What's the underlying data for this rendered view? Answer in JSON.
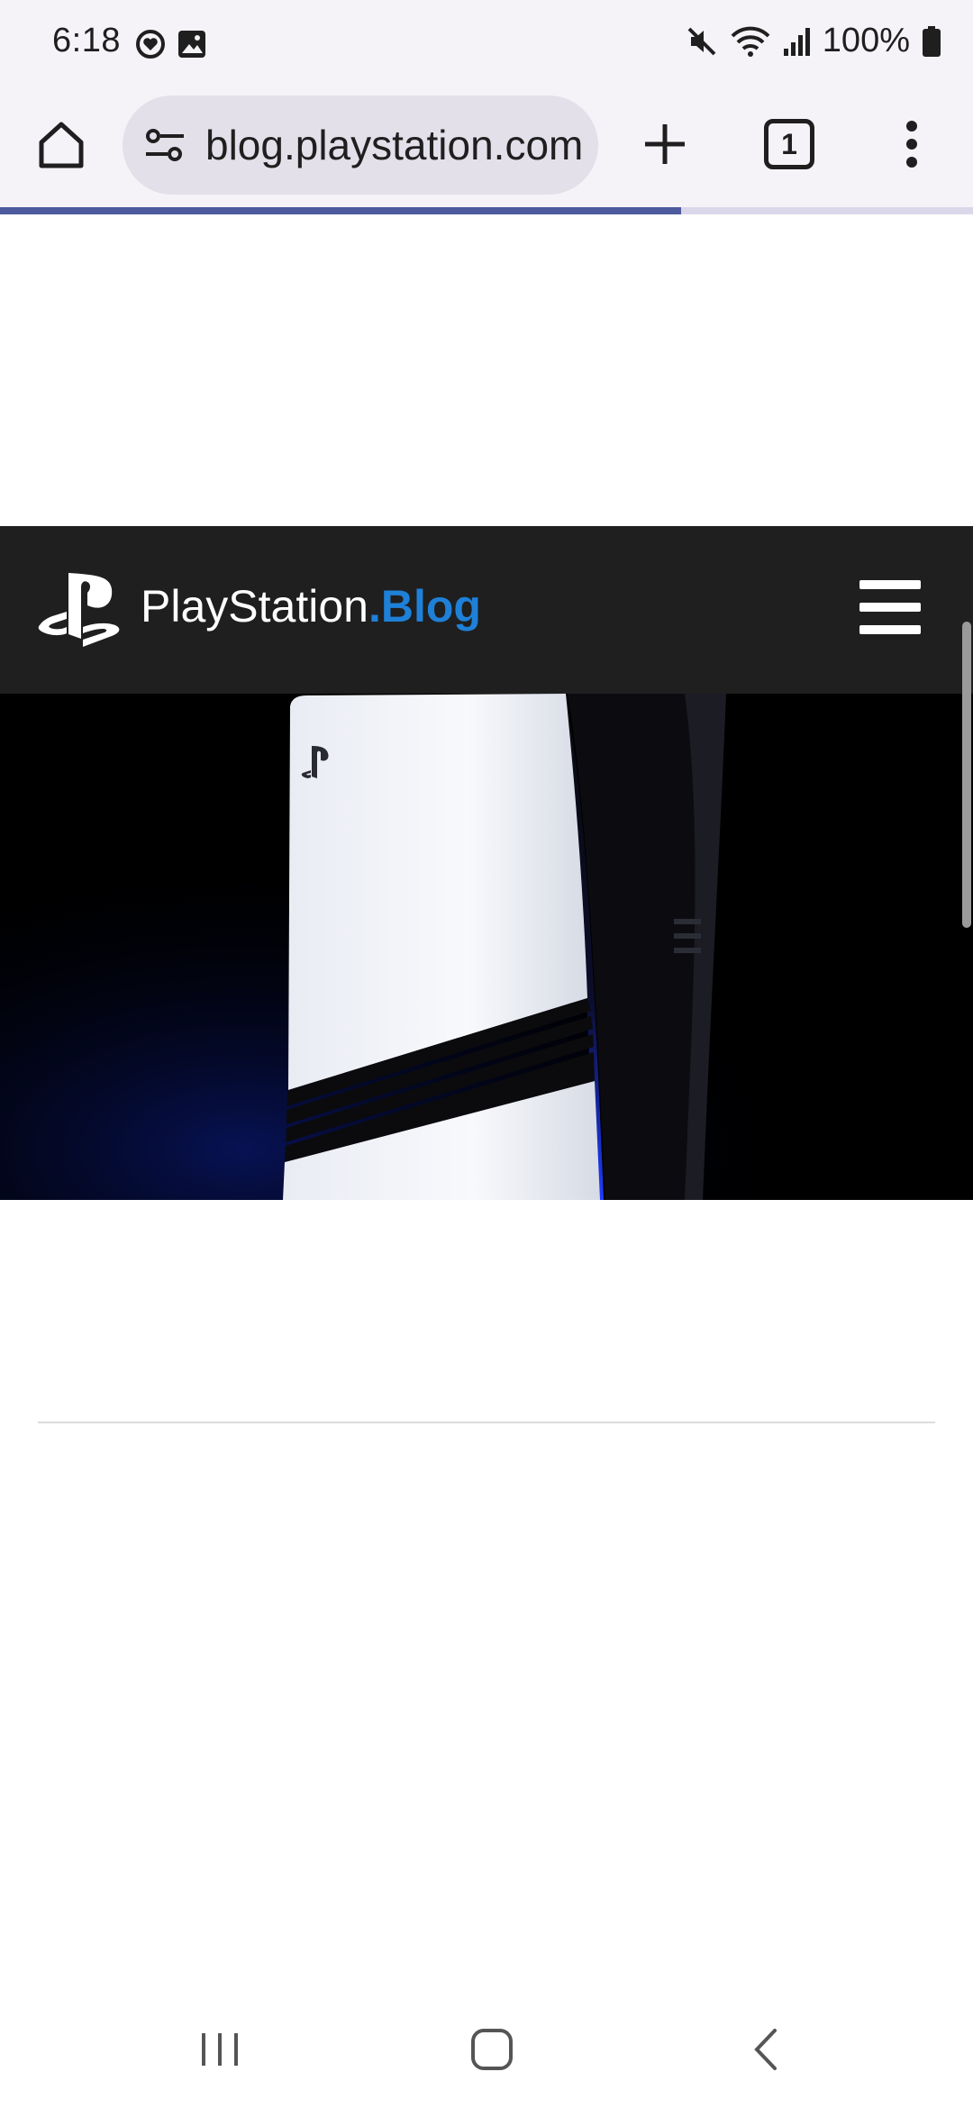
{
  "status_bar": {
    "time": "6:18",
    "battery": "100%",
    "left_icons": [
      "heart-sync-icon",
      "image-icon"
    ],
    "right_icons": [
      "mute-icon",
      "wifi-icon",
      "signal-icon",
      "battery-icon"
    ]
  },
  "browser": {
    "url": "blog.playstation.com",
    "tab_count": "1",
    "load_progress": 0.7,
    "progress_color": "#4d5b9e"
  },
  "page": {
    "site_name": "PlayStation",
    "site_accent": ".Blog",
    "accent_color": "#1f80d8",
    "header_bg": "#1f1f1f",
    "hero_subject": "PS5 console"
  },
  "nav_bar": {
    "buttons": [
      "recent-apps",
      "home",
      "back"
    ]
  }
}
